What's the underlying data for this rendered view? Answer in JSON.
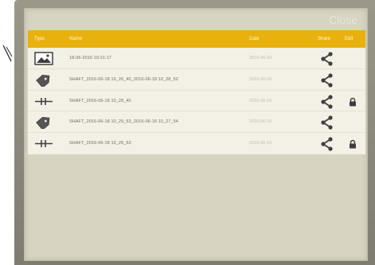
{
  "header": {
    "close_label": "Close",
    "type_label": "Type",
    "name_label": "Name",
    "date_label": "Date",
    "share_label": "Share",
    "edit_label": "Edit"
  },
  "files": [
    {
      "type_icon": "image-icon",
      "name": "18-06-2016 10:21:17",
      "date": "2016-06-18",
      "locked": false
    },
    {
      "type_icon": "tag-icon",
      "name": "SHAFT_2016-06-18 10_26_40_2016-06-18 10_28_52",
      "date": "2016-06-18",
      "locked": false
    },
    {
      "type_icon": "shaft-icon",
      "name": "SHAFT_2016-06-18 10_28_40",
      "date": "2016-06-18",
      "locked": true
    },
    {
      "type_icon": "tag-icon",
      "name": "SHAFT_2016-06-18 10_29_53_2016-06-18 10_27_54",
      "date": "2016-06-18",
      "locked": false
    },
    {
      "type_icon": "shaft-icon",
      "name": "SHAFT_2016-06-18 10_26_53",
      "date": "2016-06-18",
      "locked": true
    }
  ],
  "colors": {
    "header_bg": "#e9b10e",
    "panel_bg": "#d7d4c1",
    "list_bg": "#f3f0e6",
    "icon": "#3e3e3e"
  }
}
